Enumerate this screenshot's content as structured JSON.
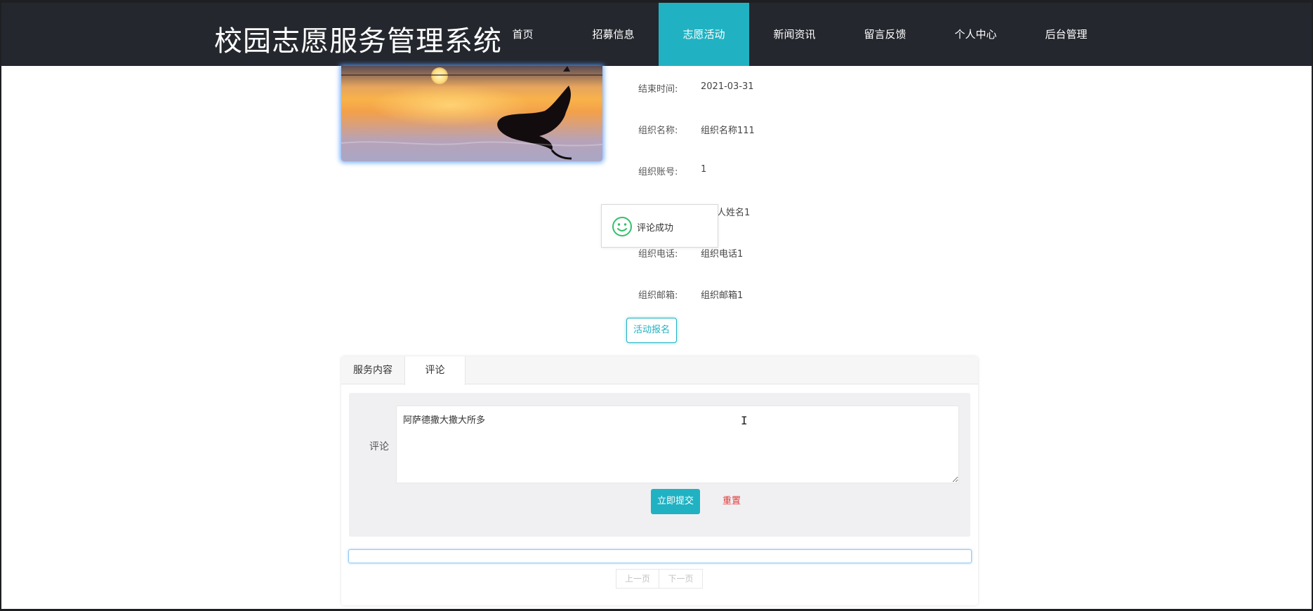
{
  "header": {
    "site_title": "校园志愿服务管理系统",
    "nav": [
      {
        "label": "首页",
        "active": false
      },
      {
        "label": "招募信息",
        "active": false
      },
      {
        "label": "志愿活动",
        "active": true
      },
      {
        "label": "新闻资讯",
        "active": false
      },
      {
        "label": "留言反馈",
        "active": false
      },
      {
        "label": "个人中心",
        "active": false
      },
      {
        "label": "后台管理",
        "active": false
      }
    ]
  },
  "details": [
    {
      "label": "结束时间:",
      "value": "2021-03-31"
    },
    {
      "label": "组织名称:",
      "value": "组织名称111"
    },
    {
      "label": "组织账号:",
      "value": "1"
    },
    {
      "label": "",
      "value": "人姓名1"
    },
    {
      "label": "组织电话:",
      "value": "组织电话1"
    },
    {
      "label": "组织邮箱:",
      "value": "组织邮箱1"
    }
  ],
  "toast": {
    "text": "评论成功",
    "icon": "smile-icon"
  },
  "signup_button": "活动报名",
  "tabs": [
    {
      "label": "服务内容",
      "active": false
    },
    {
      "label": "评论",
      "active": true
    }
  ],
  "comment_form": {
    "label": "评论",
    "value": "阿萨德撒大撒大所多",
    "submit_label": "立即提交",
    "reset_label": "重置"
  },
  "pager": {
    "prev": "上一页",
    "next": "下一页"
  },
  "colors": {
    "accent": "#20b2c2",
    "header_bg": "#24272e",
    "danger": "#e23b3b"
  }
}
